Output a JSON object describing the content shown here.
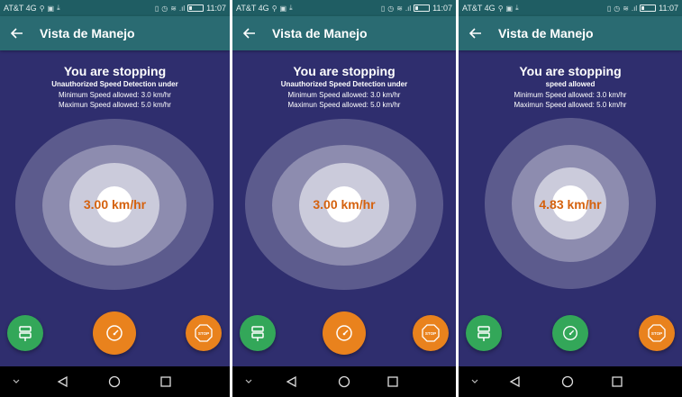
{
  "theme": {
    "background": "#2f2e6e",
    "app_bar": "#2a6b72",
    "status_bar": "#1f5d63",
    "speed_text": "#d5620f",
    "fab_green": "#33a759",
    "fab_orange": "#e9821d"
  },
  "status_bar": {
    "carrier": "AT&T 4G",
    "time": "11:07",
    "icons": [
      "location-icon",
      "image-icon",
      "download-icon",
      "vibrate-icon",
      "alarm-icon",
      "wifi-icon",
      "signal-icon",
      "battery-icon"
    ]
  },
  "screens": [
    {
      "app_title": "Vista de Manejo",
      "heading": "You are stopping",
      "subheading": "Unauthorized Speed Detection under",
      "min_speed": "Minimum Speed allowed: 3.0 km/hr",
      "max_speed": "Maximun Speed allowed: 5.0 km/hr",
      "speed": "3.00 km/hr",
      "fab_left": {
        "icon": "signpost-icon",
        "color": "#33a759"
      },
      "fab_center": {
        "icon": "speedometer-icon",
        "color": "#e9821d"
      },
      "fab_right": {
        "icon": "stop-sign-icon",
        "label": "STOP",
        "color": "#e9821d"
      }
    },
    {
      "app_title": "Vista de Manejo",
      "heading": "You are stopping",
      "subheading": "Unauthorized Speed Detection under",
      "min_speed": "Minimum Speed allowed: 3.0 km/hr",
      "max_speed": "Maximun Speed allowed: 5.0 km/hr",
      "speed": "3.00 km/hr",
      "fab_left": {
        "icon": "signpost-icon",
        "color": "#33a759"
      },
      "fab_center": {
        "icon": "speedometer-icon",
        "color": "#e9821d"
      },
      "fab_right": {
        "icon": "stop-sign-icon",
        "label": "STOP",
        "color": "#e9821d"
      }
    },
    {
      "app_title": "Vista de Manejo",
      "heading": "You are stopping",
      "subheading": "speed allowed",
      "min_speed": "Minimum Speed allowed: 3.0 km/hr",
      "max_speed": "Maximun Speed allowed: 5.0 km/hr",
      "speed": "4.83 km/hr",
      "fab_left": {
        "icon": "signpost-icon",
        "color": "#33a759"
      },
      "fab_center": {
        "icon": "speedometer-icon",
        "color": "#33a759"
      },
      "fab_right": {
        "icon": "stop-sign-icon",
        "label": "STOP",
        "color": "#e9821d"
      }
    }
  ],
  "nav_bar": {
    "icons": [
      "chevron-down-icon",
      "back-triangle-icon",
      "home-circle-icon",
      "recents-square-icon"
    ]
  }
}
